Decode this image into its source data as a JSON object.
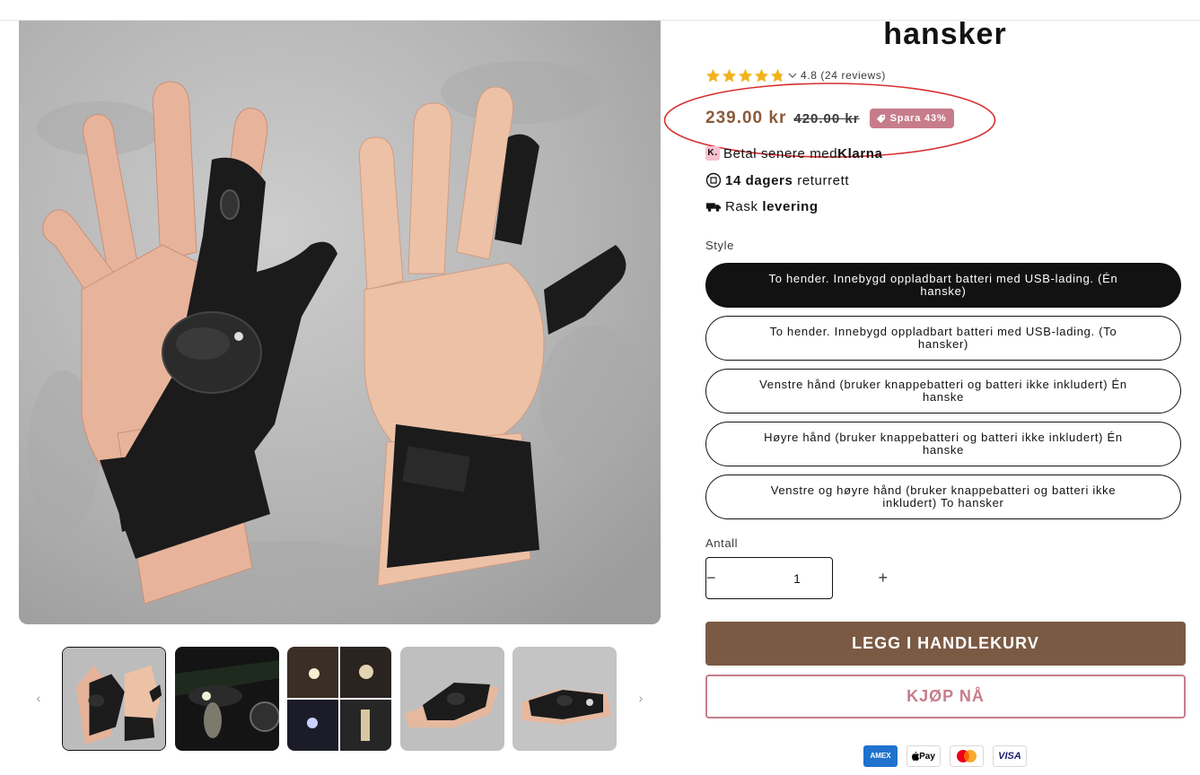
{
  "product": {
    "title": "hansker",
    "rating_text": "4.8 (24 reviews)",
    "stars": 4.8,
    "sale_price": "239.00 kr",
    "compare_price": "420.00 kr",
    "save_badge": "Spara 43%"
  },
  "benefits": [
    {
      "prefix": "Betal senere med ",
      "bold": "Klarna",
      "suffix": "",
      "icon": "klarna-icon",
      "icon_glyph": "K."
    },
    {
      "prefix": "",
      "bold": "14 dagers",
      "suffix": " returrett",
      "icon": "return-box-icon"
    },
    {
      "prefix": "Rask ",
      "bold": "levering",
      "suffix": "",
      "icon": "truck-icon"
    }
  ],
  "style": {
    "label": "Style",
    "options": [
      "To hender. Innebygd oppladbart batteri med USB-lading. (Én hanske)",
      "To hender. Innebygd oppladbart batteri med USB-lading. (To hansker)",
      "Venstre hånd (bruker knappebatteri og batteri ikke inkludert) Én hanske",
      "Høyre hånd (bruker knappebatteri og batteri ikke inkludert) Én hanske",
      "Venstre og høyre hånd (bruker knappebatteri og batteri ikke inkludert) To hansker"
    ],
    "selected_index": 0
  },
  "quantity": {
    "label": "Antall",
    "value": "1",
    "minus": "−",
    "plus": "+"
  },
  "buttons": {
    "add_to_cart": "LEGG I HANDLEKURV",
    "buy_now": "KJØP NÅ"
  },
  "gallery": {
    "prev": "‹",
    "next": "›",
    "thumbnails": [
      "hands-grey",
      "fishing-night",
      "collage",
      "gloves-grey-1",
      "gloves-grey-2"
    ],
    "active_thumbnail": 0
  },
  "payments": {
    "amex": "AMEX",
    "apple_pay": "Pay",
    "visa": "VISA"
  },
  "colors": {
    "sale": "#8a5a3b",
    "badge": "#c77c8b",
    "add_to_cart_bg": "#7b5a44",
    "highlight_ring": "#d62f2f",
    "star": "#f2b31f"
  }
}
